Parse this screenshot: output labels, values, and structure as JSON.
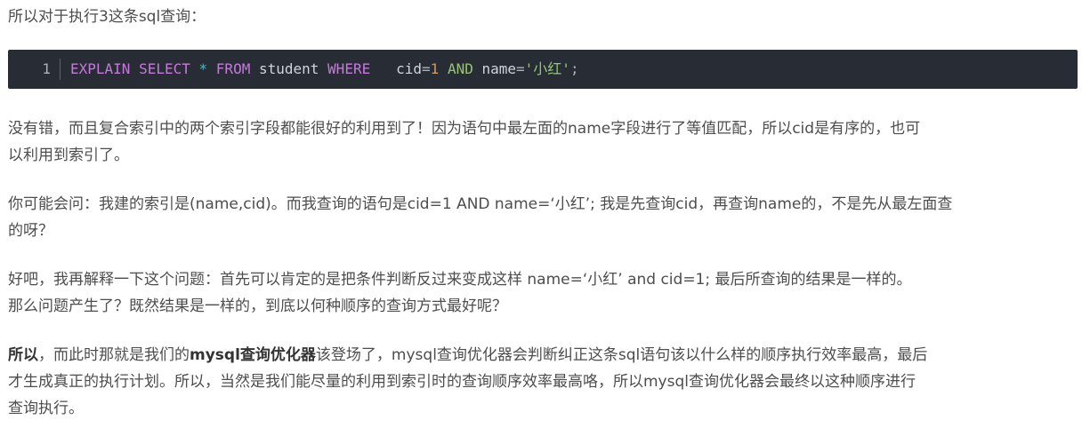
{
  "intro": "所以对于执行3这条sql查询：",
  "code": {
    "line_number": "1",
    "tokens": {
      "explain": "EXPLAIN",
      "select": "SELECT",
      "star": "*",
      "from": "FROM",
      "table": "student",
      "where": "WHERE",
      "col_cid": "cid",
      "eq1": "=",
      "one": "1",
      "and": "AND",
      "col_name": "name",
      "eq2": "=",
      "str_val": "'小红'",
      "semicolon": ";"
    }
  },
  "paragraphs": {
    "p1": {
      "line1": "没有错，而且复合索引中的两个索引字段都能很好的利用到了！因为语句中最左面的name字段进行了等值匹配，所以cid是有序的，也可",
      "line2": "以利用到索引了。"
    },
    "p2": {
      "line1": "你可能会问：我建的索引是(name,cid)。而我查询的语句是cid=1 AND name=‘小红’; 我是先查询cid，再查询name的，不是先从最左面查",
      "line2": "的呀？"
    },
    "p3": {
      "line1": "好吧，我再解释一下这个问题：首先可以肯定的是把条件判断反过来变成这样 name=‘小红’ and cid=1; 最后所查询的结果是一样的。",
      "line2": "那么问题产生了？既然结果是一样的，到底以何种顺序的查询方式最好呢？"
    },
    "p4": {
      "bold1": "所以",
      "text1": "，而此时那就是我们的",
      "bold2": "mysql查询优化器",
      "text2": "该登场了，mysql查询优化器会判断纠正这条sql语句该以什么样的顺序执行效率最高，最后",
      "line2": "才生成真正的执行计划。所以，当然是我们能尽量的利用到索引时的查询顺序效率最高咯，所以mysql查询优化器会最终以这种顺序进行",
      "line3": "查询执行。"
    }
  }
}
